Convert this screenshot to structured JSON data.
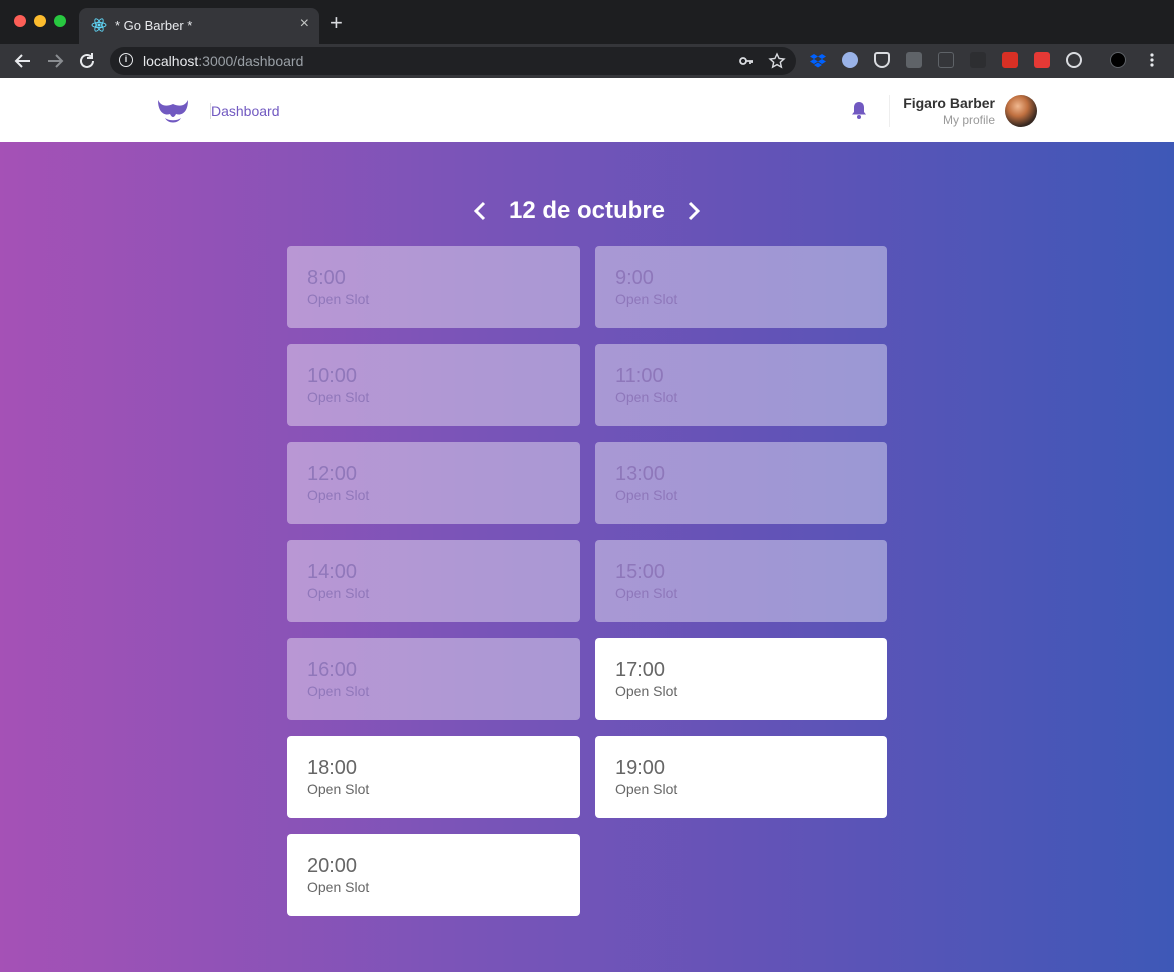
{
  "browser": {
    "tab_title": "* Go Barber *",
    "tab_close": "×",
    "new_tab": "+",
    "url_host": "localhost",
    "url_rest": ":3000/dashboard",
    "icons": [
      "back-icon",
      "forward-icon",
      "reload-icon",
      "info-icon",
      "key-icon",
      "star-icon"
    ]
  },
  "header": {
    "nav_dashboard": "Dashboard",
    "profile_name": "Figaro Barber",
    "profile_link": "My profile",
    "accent": "#7159c1"
  },
  "schedule": {
    "date": "12 de octubre",
    "slots": [
      {
        "time": "8:00",
        "status": "Open Slot",
        "past": true
      },
      {
        "time": "9:00",
        "status": "Open Slot",
        "past": true
      },
      {
        "time": "10:00",
        "status": "Open Slot",
        "past": true
      },
      {
        "time": "11:00",
        "status": "Open Slot",
        "past": true
      },
      {
        "time": "12:00",
        "status": "Open Slot",
        "past": true
      },
      {
        "time": "13:00",
        "status": "Open Slot",
        "past": true
      },
      {
        "time": "14:00",
        "status": "Open Slot",
        "past": true
      },
      {
        "time": "15:00",
        "status": "Open Slot",
        "past": true
      },
      {
        "time": "16:00",
        "status": "Open Slot",
        "past": true
      },
      {
        "time": "17:00",
        "status": "Open Slot",
        "past": false
      },
      {
        "time": "18:00",
        "status": "Open Slot",
        "past": false
      },
      {
        "time": "19:00",
        "status": "Open Slot",
        "past": false
      },
      {
        "time": "20:00",
        "status": "Open Slot",
        "past": false
      }
    ]
  }
}
